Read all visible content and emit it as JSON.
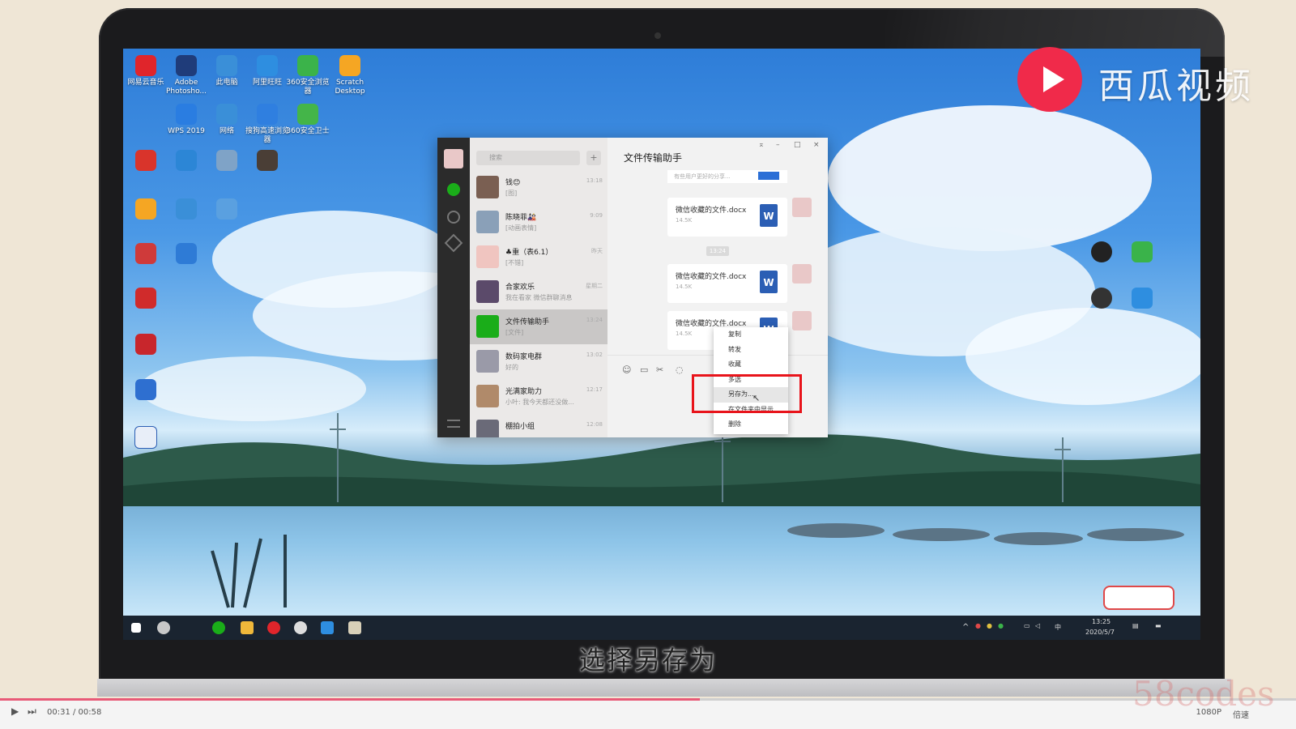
{
  "watermark": {
    "brand": "西瓜视频",
    "site": "58codes"
  },
  "desktop_icons": [
    {
      "label": "网易云音乐",
      "icon": "netease-music-icon",
      "color": "#e0252b"
    },
    {
      "label": "Adobe Photosho...",
      "icon": "photoshop-icon",
      "color": "#1f3c7a"
    },
    {
      "label": "此电脑",
      "icon": "computer-icon",
      "color": "#3a8fd8"
    },
    {
      "label": "阿里旺旺",
      "icon": "aliwangwang-icon",
      "color": "#2e8ee0"
    },
    {
      "label": "360安全浏览器",
      "icon": "browser-360-icon",
      "color": "#3bb34a"
    },
    {
      "label": "Scratch Desktop",
      "icon": "scratch-icon",
      "color": "#f5a623"
    },
    {
      "label": "WPS 2019",
      "icon": "wps-icon",
      "color": "#2a7de1"
    },
    {
      "label": "网络",
      "icon": "network-icon",
      "color": "#3a8fd8"
    },
    {
      "label": "搜狗高速浏览器",
      "icon": "sogou-browser-icon",
      "color": "#2f7fe0"
    },
    {
      "label": "360安全卫士",
      "icon": "security-360-icon",
      "color": "#44b549"
    }
  ],
  "wechat": {
    "search_placeholder": "搜索",
    "chat_title": "文件传输助手",
    "chats": [
      {
        "name": "钱😊",
        "preview": "[图]",
        "time": "13:18"
      },
      {
        "name": "陈晓菲🎎",
        "preview": "[动画表情]",
        "time": "9:09"
      },
      {
        "name": "♣重（表6.1）",
        "preview": "[不错]",
        "time": "昨天"
      },
      {
        "name": "合家欢乐",
        "preview": "我在看家 微信群聊消息",
        "time": "星期二"
      },
      {
        "name": "文件传输助手",
        "preview": "[文件]",
        "time": "13:24"
      },
      {
        "name": "数码家电群",
        "preview": "好的",
        "time": "13:02"
      },
      {
        "name": "光满家助力",
        "preview": "小叶: 我今天都还没做...",
        "time": "12:17"
      },
      {
        "name": "棚拍小组",
        "preview": "",
        "time": "12:08"
      }
    ],
    "messages": [
      {
        "file": "微信收藏的文件.docx",
        "size": "14.5K"
      },
      {
        "file": "微信收藏的文件.docx",
        "size": "14.5K"
      },
      {
        "file": "微信收藏的文件.docx",
        "size": "14.5K"
      }
    ],
    "top_note": "有些用户更好的分享...",
    "time_divider": "13:24",
    "context_menu": [
      "复制",
      "转发",
      "收藏",
      "多选",
      "另存为...",
      "在文件夹中显示",
      "删除"
    ]
  },
  "taskbar": {
    "clock_time": "13:25",
    "clock_date": "2020/5/7",
    "ime": "中"
  },
  "subtitle": "选择另存为",
  "player": {
    "time": "00:31 / 00:58",
    "progress": 0.54,
    "quality": "1080P",
    "speed": "倍速"
  }
}
